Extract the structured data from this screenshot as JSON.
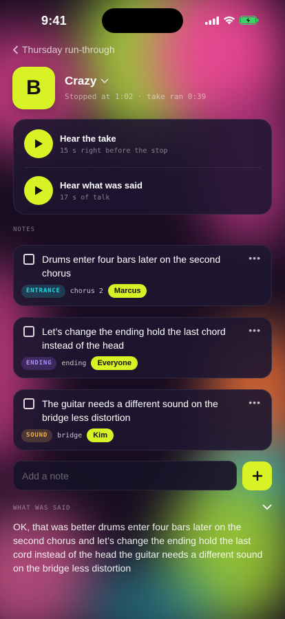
{
  "status": {
    "time": "9:41"
  },
  "back": {
    "label": "Thursday run-through"
  },
  "song": {
    "badge": "B",
    "title": "Crazy",
    "subtitle": "Stopped at 1:02 · take ran 0:39"
  },
  "playback": [
    {
      "title": "Hear the take",
      "subtitle": "15 s right before the stop"
    },
    {
      "title": "Hear what was said",
      "subtitle": "17 s of talk"
    }
  ],
  "notes_label": "NOTES",
  "notes": [
    {
      "text": "Drums enter four bars later on the second chorus",
      "tag": "ENTRANCE",
      "tag_color": "#1fd6e0",
      "where": "chorus 2",
      "who": "Marcus"
    },
    {
      "text": "Let’s change the ending hold the last chord instead of the head",
      "tag": "ENDING",
      "tag_color": "#b08cff",
      "where": "ending",
      "who": "Everyone"
    },
    {
      "text": "The guitar needs a different sound on the bridge less distortion",
      "tag": "SOUND",
      "tag_color": "#f0b24a",
      "where": "bridge",
      "who": "Kim"
    }
  ],
  "add_note": {
    "placeholder": "Add a note"
  },
  "said_label": "WHAT WAS SAID",
  "transcript": "OK, that was better drums enter four bars later on the second chorus and let’s change the ending hold the last cord instead of the head the guitar needs a different sound on the bridge less distortion",
  "colors": {
    "accent": "#d8f225",
    "card": "#1e1630",
    "background": "#170d22"
  }
}
